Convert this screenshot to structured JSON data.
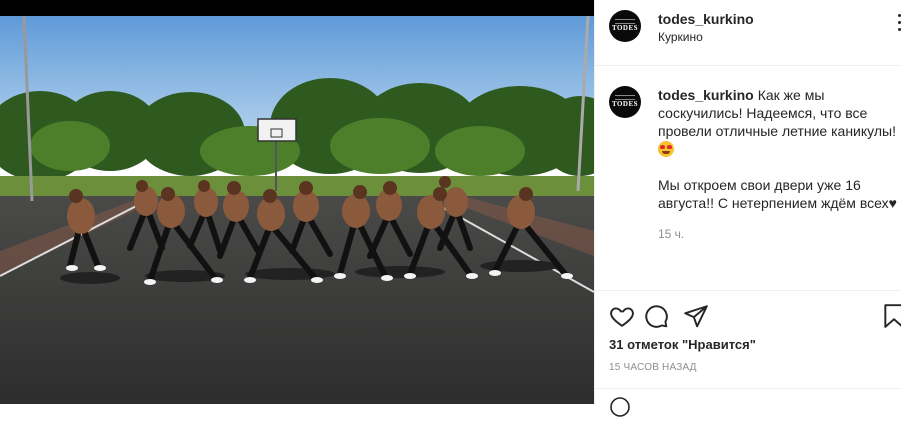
{
  "post": {
    "username": "todes_kurkino",
    "location": "Куркино",
    "avatar_text": "TODES",
    "caption_line1": "Как же мы соскучились! Надеемся, что все провели отличные летние каникулы!",
    "caption_line2": "Мы откроем свои двери уже 16 августа!! С нетерпением ждём всех",
    "caption_heart": "♥",
    "caption_time": "15 ч.",
    "likes_text": "31 отметок \"Нравится\"",
    "posted_ago": "15 часов назад"
  },
  "icons": [
    "more-icon",
    "heart-icon",
    "comment-icon",
    "share-icon",
    "bookmark-icon",
    "smiley-emoji"
  ],
  "colors": {
    "text": "#262626",
    "secondary": "#8e8e8e",
    "divider": "#efefef",
    "sky": "#7fb3e6",
    "asphalt": "#3a3a3a"
  }
}
